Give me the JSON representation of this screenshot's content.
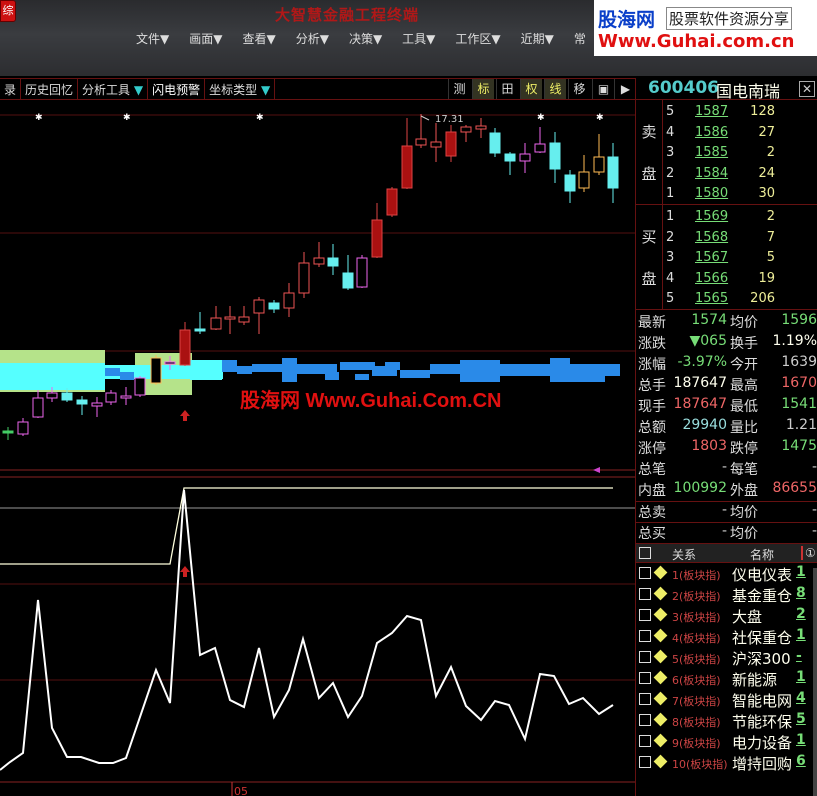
{
  "app": {
    "title": "大智慧金融工程终端",
    "corner": "综"
  },
  "menu": [
    "文件▼",
    "画面▼",
    "查看▼",
    "分析▼",
    "决策▼",
    "工具▼",
    "工作区▼",
    "近期▼",
    "常"
  ],
  "logo": {
    "brand": "股海网",
    "slogan": "股票软件资源分享",
    "url": "Www.Guhai.com.cn"
  },
  "toolbar": {
    "items": [
      "录",
      "历史回忆",
      "分析工具",
      "闪电预警",
      "坐标类型"
    ],
    "tri": "▼",
    "right": [
      "测",
      "标",
      "田",
      "权",
      "线",
      "移",
      "▣",
      "▶"
    ]
  },
  "chart": {
    "high_label": "17.31",
    "watermark": "股海网 Www.Guhai.Com.CN",
    "axis_label": "05"
  },
  "stock": {
    "code": "600406",
    "name": "国电南瑞",
    "close": "✕"
  },
  "ask": {
    "label": [
      "卖",
      "盘"
    ],
    "rows": [
      {
        "lv": "5",
        "price": "1587",
        "vol": "128"
      },
      {
        "lv": "4",
        "price": "1586",
        "vol": "27"
      },
      {
        "lv": "3",
        "price": "1585",
        "vol": "2"
      },
      {
        "lv": "2",
        "price": "1584",
        "vol": "24"
      },
      {
        "lv": "1",
        "price": "1580",
        "vol": "30"
      }
    ]
  },
  "bid": {
    "label": [
      "买",
      "盘"
    ],
    "rows": [
      {
        "lv": "1",
        "price": "1569",
        "vol": "2"
      },
      {
        "lv": "2",
        "price": "1568",
        "vol": "7"
      },
      {
        "lv": "3",
        "price": "1567",
        "vol": "5"
      },
      {
        "lv": "4",
        "price": "1566",
        "vol": "19"
      },
      {
        "lv": "5",
        "price": "1565",
        "vol": "206"
      }
    ]
  },
  "quote": [
    {
      "l1": "最新",
      "v1": "1574",
      "c1": "green",
      "l2": "均价",
      "v2": "1596",
      "c2": "green"
    },
    {
      "l1": "涨跌",
      "v1": "▼065",
      "c1": "green",
      "l2": "换手",
      "v2": "1.19%",
      "c2": "yellow"
    },
    {
      "l1": "涨幅",
      "v1": "-3.97%",
      "c1": "green",
      "l2": "今开",
      "v2": "1639",
      "c2": "gray"
    },
    {
      "l1": "总手",
      "v1": "187647",
      "c1": "white",
      "l2": "最高",
      "v2": "1670",
      "c2": "red"
    },
    {
      "l1": "现手",
      "v1": "187647",
      "c1": "red",
      "l2": "最低",
      "v2": "1541",
      "c2": "green"
    },
    {
      "l1": "总额",
      "v1": "29940",
      "c1": "cyan",
      "l2": "量比",
      "v2": "1.21",
      "c2": "gray"
    },
    {
      "l1": "涨停",
      "v1": "1803",
      "c1": "red",
      "l2": "跌停",
      "v2": "1475",
      "c2": "green"
    },
    {
      "l1": "总笔",
      "v1": "-",
      "c1": "gray",
      "l2": "每笔",
      "v2": "-",
      "c2": "gray"
    },
    {
      "l1": "内盘",
      "v1": "100992",
      "c1": "green",
      "l2": "外盘",
      "v2": "86655",
      "c2": "red"
    },
    {
      "l1": "总卖",
      "v1": "-",
      "c1": "gray",
      "l2": "均价",
      "v2": "-",
      "c2": "gray"
    },
    {
      "l1": "总买",
      "v1": "-",
      "c1": "gray",
      "l2": "均价",
      "v2": "-",
      "c2": "gray"
    }
  ],
  "related": {
    "headers": [
      "关系",
      "名称",
      "①"
    ],
    "rows": [
      {
        "type": "1(板块指)",
        "name": "仪电仪表",
        "val": "1"
      },
      {
        "type": "2(板块指)",
        "name": "基金重仓",
        "val": "8"
      },
      {
        "type": "3(板块指)",
        "name": "大盘",
        "val": "2"
      },
      {
        "type": "4(板块指)",
        "name": "社保重仓",
        "val": "1"
      },
      {
        "type": "5(板块指)",
        "name": "沪深300",
        "val": "-"
      },
      {
        "type": "6(板块指)",
        "name": "新能源",
        "val": "1"
      },
      {
        "type": "7(板块指)",
        "name": "智能电网",
        "val": "4"
      },
      {
        "type": "8(板块指)",
        "name": "节能环保",
        "val": "5"
      },
      {
        "type": "9(板块指)",
        "name": "电力设备",
        "val": "1"
      },
      {
        "type": "10(板块指)",
        "name": "增持回购",
        "val": "6"
      }
    ]
  }
}
